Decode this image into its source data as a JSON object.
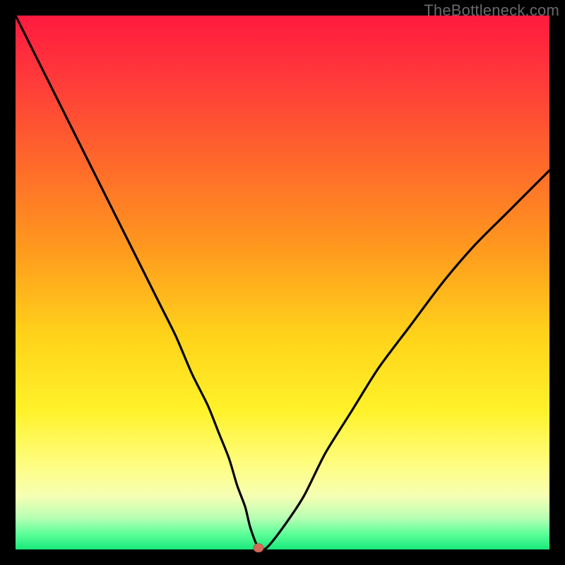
{
  "watermark": "TheBottleneck.com",
  "chart_data": {
    "type": "line",
    "title": "",
    "xlabel": "",
    "ylabel": "",
    "xlim": [
      0,
      100
    ],
    "ylim": [
      0,
      100
    ],
    "series": [
      {
        "name": "bottleneck-curve",
        "x": [
          0,
          3,
          6,
          9,
          12,
          15,
          18,
          21,
          24,
          27,
          30,
          33,
          36,
          38,
          40,
          41.5,
          43,
          44,
          45.5,
          47,
          50,
          54,
          58,
          63,
          68,
          74,
          80,
          86,
          92,
          97,
          100
        ],
        "values": [
          100,
          94,
          88,
          82,
          76,
          70,
          64,
          58,
          52,
          46,
          40,
          33,
          27,
          22,
          17,
          12,
          8,
          4,
          0.3,
          0.3,
          4,
          10,
          18,
          26,
          34,
          42,
          50,
          57,
          63,
          68,
          71
        ]
      }
    ],
    "marker": {
      "x": 45.5,
      "y": 0.3,
      "color": "#d46a5a",
      "radius_px": 6
    },
    "gradient_stops": [
      {
        "pos": 0.0,
        "color": "#ff1a3f"
      },
      {
        "pos": 0.12,
        "color": "#ff3a3a"
      },
      {
        "pos": 0.28,
        "color": "#ff6a2a"
      },
      {
        "pos": 0.44,
        "color": "#ff9a1e"
      },
      {
        "pos": 0.6,
        "color": "#ffd31a"
      },
      {
        "pos": 0.74,
        "color": "#fff22a"
      },
      {
        "pos": 0.84,
        "color": "#fffd80"
      },
      {
        "pos": 0.9,
        "color": "#f6ffb3"
      },
      {
        "pos": 0.94,
        "color": "#b9ffb4"
      },
      {
        "pos": 0.97,
        "color": "#5fff9a"
      },
      {
        "pos": 1.0,
        "color": "#18e87a"
      }
    ]
  }
}
